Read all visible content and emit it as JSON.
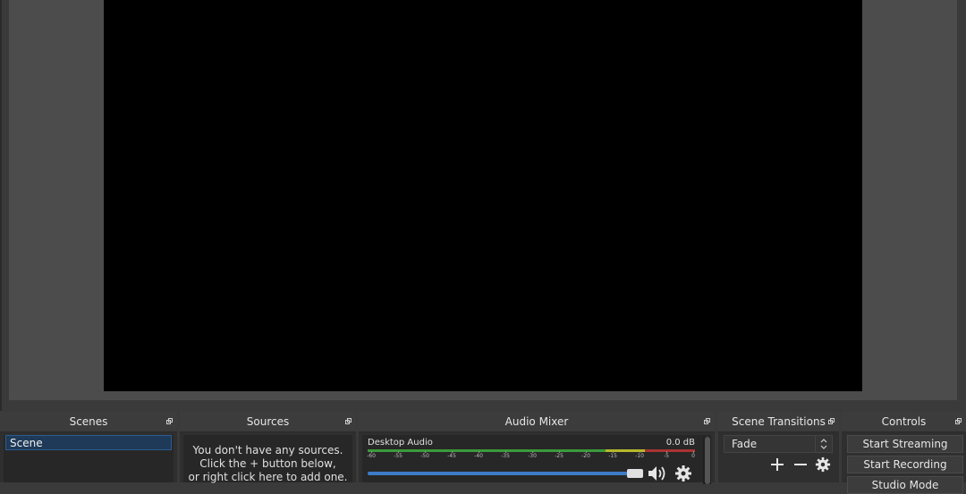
{
  "docks": {
    "scenes": {
      "title": "Scenes",
      "items": [
        "Scene"
      ]
    },
    "sources": {
      "title": "Sources",
      "empty_lines": [
        "You don't have any sources.",
        "Click the + button below,",
        "or right click here to add one."
      ]
    },
    "audio_mixer": {
      "title": "Audio Mixer",
      "channel": {
        "name": "Desktop Audio",
        "level": "0.0 dB",
        "volume": 1.0
      },
      "scale": [
        "-60",
        "-55",
        "-50",
        "-45",
        "-40",
        "-35",
        "-30",
        "-25",
        "-20",
        "-15",
        "-10",
        "-5",
        "0"
      ]
    },
    "transitions": {
      "title": "Scene Transitions",
      "selected": "Fade"
    },
    "controls": {
      "title": "Controls",
      "buttons": [
        "Start Streaming",
        "Start Recording",
        "Studio Mode"
      ]
    }
  },
  "icons": [
    "undock-icon",
    "speaker-icon",
    "gear-icon",
    "plus-icon",
    "minus-icon",
    "spinner-arrows-icon"
  ],
  "colors": {
    "background": "#3a3a3a",
    "preview": "#000000",
    "selection": "#1e3a58",
    "meter_green": "#3a9a3a",
    "meter_yellow": "#b8b82a",
    "meter_red": "#aa3333",
    "slider": "#3d7cc9"
  }
}
